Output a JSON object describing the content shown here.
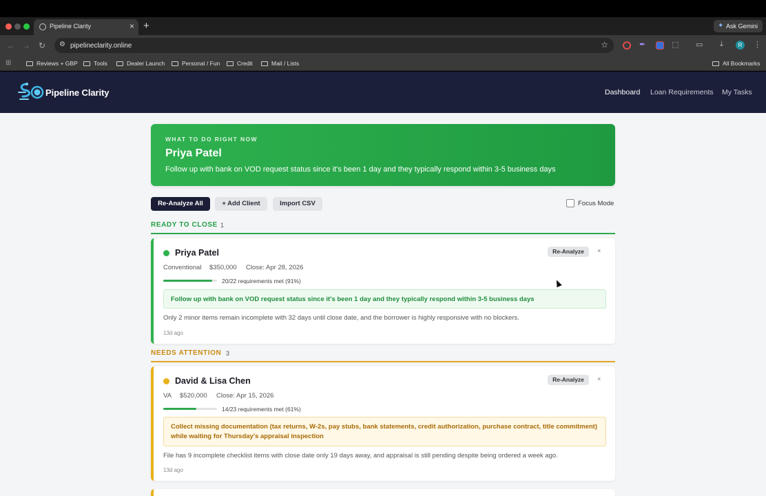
{
  "browser": {
    "tab_title": "Pipeline Clarity",
    "tab_close": "×",
    "new_tab": "+",
    "ask_gemini": "Ask Gemini",
    "url": "pipelineclarity.online",
    "profile_initial": "R",
    "bookmarks": [
      "Reviews + GBP",
      "Tools",
      "Dealer Launch",
      "Personal / Fun",
      "Credit",
      "Mail / Lists"
    ],
    "all_bookmarks": "All Bookmarks"
  },
  "app": {
    "logo_text": "Pipeline Clarity",
    "nav": [
      "Dashboard",
      "Loan Requirements",
      "My Tasks"
    ],
    "active_nav": "Dashboard"
  },
  "hero": {
    "eyebrow": "WHAT TO DO RIGHT NOW",
    "name": "Priya Patel",
    "action": "Follow up with bank on VOD request status since it's been 1 day and they typically respond within 3-5 business days"
  },
  "actions": {
    "reanalyze_all": "Re-Analyze All",
    "add_client": "+ Add Client",
    "import_csv": "Import CSV",
    "focus_mode": "Focus Mode"
  },
  "sections": [
    {
      "title": "READY TO CLOSE",
      "count": "1",
      "color": "#23a046",
      "cards": [
        {
          "name": "Priya Patel",
          "loan_type": "Conventional",
          "amount": "$350,000",
          "close": "Close: Apr 28, 2026",
          "progress": 0.91,
          "requirements": "20/22 requirements met (91%)",
          "callout": "Follow up with bank on VOD request status since it's been 1 day and they typically respond within 3-5 business days",
          "summary": "Only 2 minor items remain incomplete with 32 days until close date, and the borrower is highly responsive with no blockers.",
          "ago": "13d ago",
          "reanalyze": "Re-Analyze",
          "close_icon": "×"
        }
      ]
    },
    {
      "title": "NEEDS ATTENTION",
      "count": "3",
      "color": "#c98a12",
      "cards": [
        {
          "name": "David & Lisa Chen",
          "loan_type": "VA",
          "amount": "$520,000",
          "close": "Close: Apr 15, 2026",
          "progress": 0.61,
          "requirements": "14/23 requirements met (61%)",
          "callout": "Collect missing documentation (tax returns, W-2s, pay stubs, bank statements, credit authorization, purchase contract, title commitment) while waiting for Thursday's appraisal inspection",
          "summary": "File has 9 incomplete checklist items with close date only 19 days away, and appraisal is still pending despite being ordered a week ago.",
          "ago": "13d ago",
          "reanalyze": "Re-Analyze",
          "close_icon": "×"
        }
      ]
    }
  ],
  "colors": {
    "green": "#2fb24f",
    "amber": "#e8b21c",
    "navy": "#1c1f3a"
  }
}
